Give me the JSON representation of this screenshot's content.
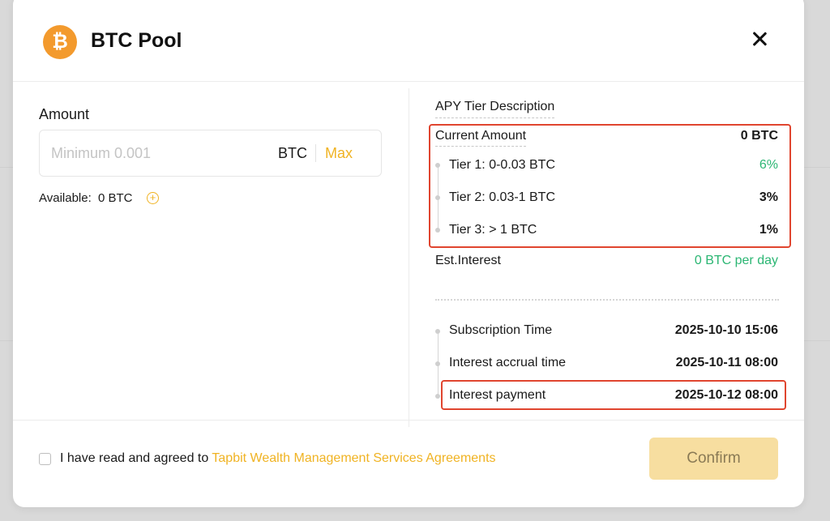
{
  "modal": {
    "title": "BTC Pool",
    "coin_symbol": "₿"
  },
  "amount": {
    "label": "Amount",
    "placeholder": "Minimum 0.001",
    "unit": "BTC",
    "max_label": "Max",
    "available_label": "Available:",
    "available_value": "0",
    "available_unit": "BTC"
  },
  "apy": {
    "title": "APY Tier Description",
    "current_amount_label": "Current Amount",
    "current_amount_value": "0 BTC",
    "tiers": [
      {
        "label": "Tier 1: 0-0.03 BTC",
        "rate": "6%"
      },
      {
        "label": "Tier 2: 0.03-1 BTC",
        "rate": "3%"
      },
      {
        "label": "Tier 3:  > 1 BTC",
        "rate": "1%"
      }
    ],
    "est_interest_label": "Est.Interest",
    "est_interest_value": "0 BTC per day"
  },
  "timeline": [
    {
      "label": "Subscription Time",
      "value": "2025-10-10 15:06"
    },
    {
      "label": "Interest accrual time",
      "value": "2025-10-11 08:00"
    },
    {
      "label": "Interest payment",
      "value": "2025-10-12 08:00"
    }
  ],
  "footer": {
    "agree_text": "I have read and agreed to ",
    "agree_link": "Tapbit Wealth Management Services Agreements",
    "confirm_label": "Confirm"
  },
  "colors": {
    "accent": "#f0b323",
    "green": "#2bb673",
    "highlight": "#e0452f",
    "coin": "#f39a2d"
  }
}
